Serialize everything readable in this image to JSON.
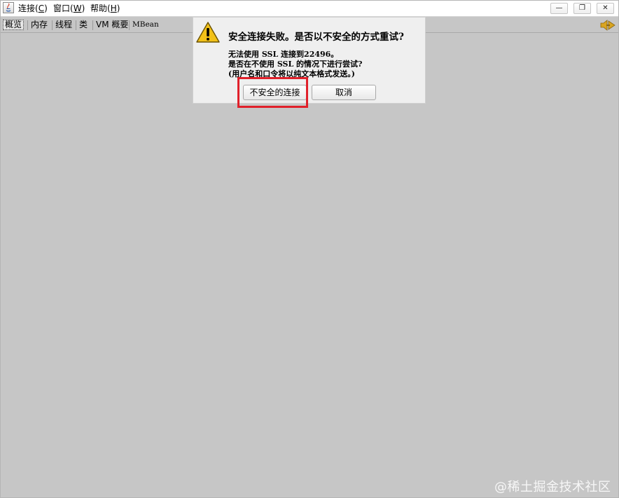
{
  "menu": {
    "items": [
      {
        "label": "连接(",
        "mnemonic": "C",
        "suffix": ")"
      },
      {
        "label": "窗口(",
        "mnemonic": "W",
        "suffix": ")"
      },
      {
        "label": "帮助(",
        "mnemonic": "H",
        "suffix": ")"
      }
    ]
  },
  "window_controls": {
    "minimize": "—",
    "restore": "❐",
    "close": "✕"
  },
  "tabs": [
    {
      "label": "概览",
      "selected": true
    },
    {
      "label": "内存"
    },
    {
      "label": "线程"
    },
    {
      "label": "类"
    },
    {
      "label": "VM 概要"
    },
    {
      "label": "MBean"
    }
  ],
  "icons": {
    "app": "java-app-icon",
    "warning": "warning-triangle-icon",
    "speaker": "connection-status-icon"
  },
  "dialog": {
    "title": "安全连接失败。是否以不安全的方式重试?",
    "lines": [
      "无法使用 SSL 连接到22496。",
      "是否在不使用 SSL 的情况下进行尝试?",
      "(用户名和口令将以纯文本格式发送。)"
    ],
    "insecure_button": "不安全的连接",
    "cancel_button": "取消"
  },
  "watermark": "@稀土掘金技术社区",
  "colors": {
    "content_bg": "#c6c6c6",
    "dialog_bg": "#efefef",
    "highlight": "#e0202a",
    "warning_fill": "#f2c118"
  }
}
